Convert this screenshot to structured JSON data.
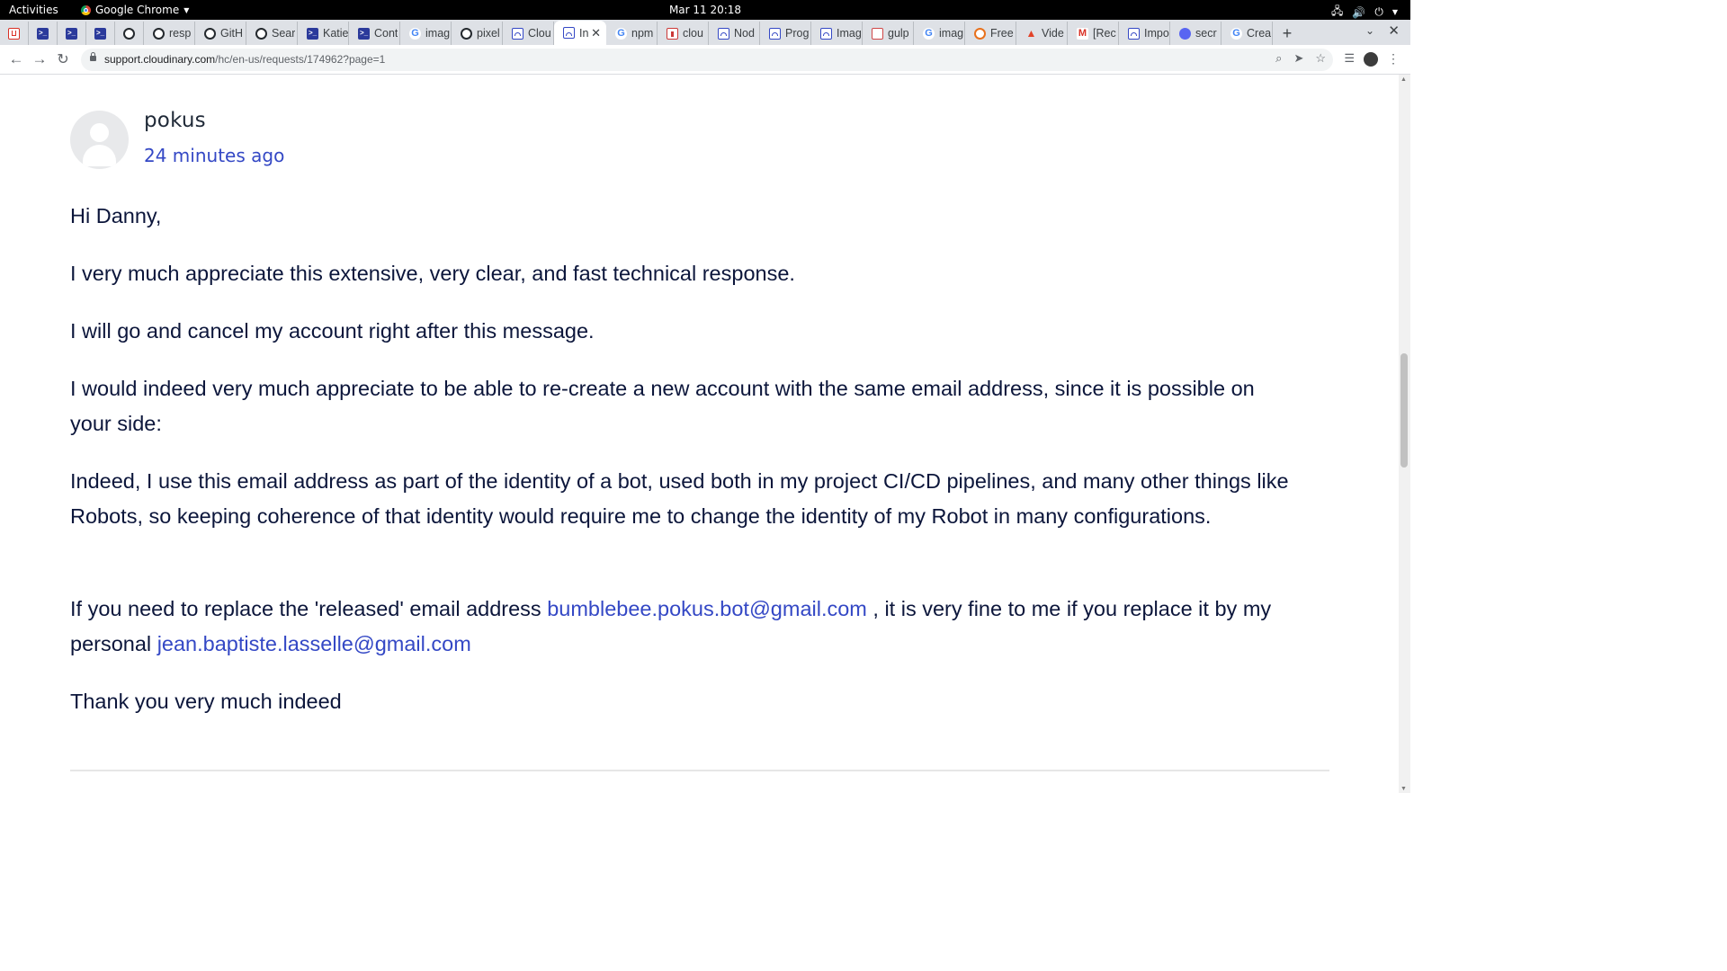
{
  "system": {
    "activities": "Activities",
    "app_name": "Google Chrome",
    "clock": "Mar 11  20:18"
  },
  "tabs": [
    {
      "label": "",
      "icon": "gmail-icon",
      "pinned": true
    },
    {
      "label": "",
      "icon": "terminal-icon",
      "pinned": true
    },
    {
      "label": "",
      "icon": "terminal-icon",
      "pinned": true
    },
    {
      "label": "",
      "icon": "terminal-icon",
      "pinned": true
    },
    {
      "label": "",
      "icon": "github-icon",
      "pinned": true
    },
    {
      "label": "resp",
      "icon": "github-icon"
    },
    {
      "label": "GitH",
      "icon": "github-icon"
    },
    {
      "label": "Sear",
      "icon": "github-icon"
    },
    {
      "label": "Katie",
      "icon": "terminal-icon"
    },
    {
      "label": "Cont",
      "icon": "terminal-icon"
    },
    {
      "label": "imag",
      "icon": "google-icon"
    },
    {
      "label": "pixel",
      "icon": "github-icon"
    },
    {
      "label": "Clou",
      "icon": "cloudinary-icon"
    },
    {
      "label": "In",
      "icon": "cloudinary-icon",
      "active": true
    },
    {
      "label": "npm",
      "icon": "google-icon"
    },
    {
      "label": "clou",
      "icon": "npm-icon"
    },
    {
      "label": "Nod",
      "icon": "cloudinary-icon"
    },
    {
      "label": "Prog",
      "icon": "cloudinary-icon"
    },
    {
      "label": "Imag",
      "icon": "cloudinary-icon"
    },
    {
      "label": "gulp",
      "icon": "gulp-icon"
    },
    {
      "label": "imag",
      "icon": "google-icon"
    },
    {
      "label": "Free",
      "icon": "freecodecamp-icon"
    },
    {
      "label": "Vide",
      "icon": "gitlab-icon"
    },
    {
      "label": "[Rec",
      "icon": "gmail-m-icon"
    },
    {
      "label": "Impo",
      "icon": "cloudinary-icon"
    },
    {
      "label": "secr",
      "icon": "discord-icon"
    },
    {
      "label": "Crea",
      "icon": "google-icon"
    }
  ],
  "toolbar": {
    "url_host": "support.cloudinary.com",
    "url_path": "/hc/en-us/requests/174962?page=1"
  },
  "comment": {
    "author": "pokus",
    "time_ago": "24 minutes ago",
    "greeting": "Hi Danny,",
    "p1": "I very much appreciate this extensive, very clear, and fast technical response.",
    "p2": "I will go and cancel my account right after this message.",
    "p3": "I would indeed very much appreciate to be able to re-create a new account with the same email address, since it is possible on your side:",
    "p4": "Indeed, I use this email address as part of the identity of a bot, used both in my project CI/CD pipelines, and many other things like Robots, so keeping coherence of that identity would require me to change the identity of my Robot in many configurations.",
    "p5_before": "If you need to replace the 'released' email address ",
    "p5_email1": "bumblebee.pokus.bot@gmail.com",
    "p5_middle": " , it is very fine to me if you replace it by my personal ",
    "p5_email2": "jean.baptiste.lasselle@gmail.com",
    "p6": "Thank you very much indeed"
  }
}
